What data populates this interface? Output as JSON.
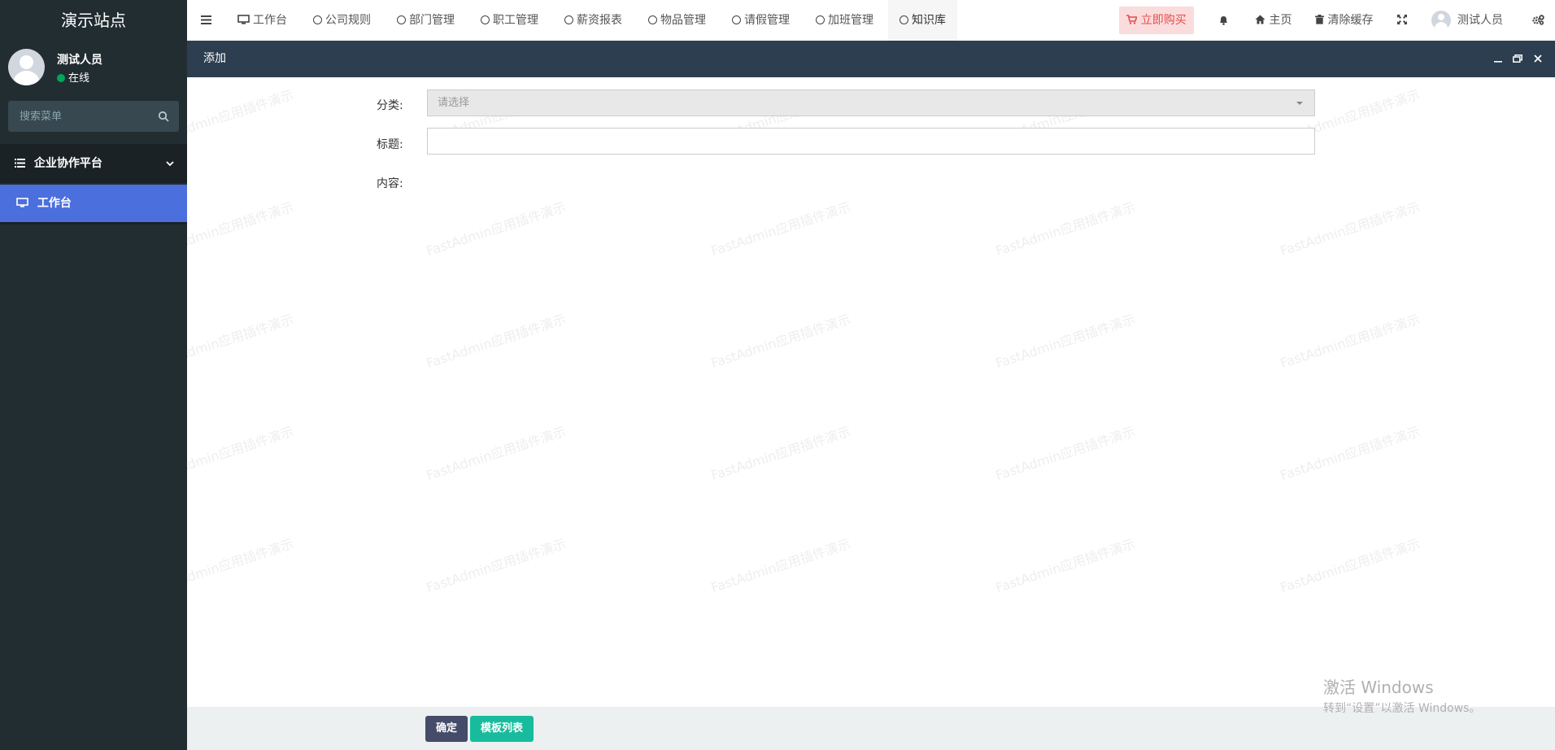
{
  "sidebar": {
    "site_title": "演示站点",
    "user_name": "测试人员",
    "user_status": "在线",
    "search_placeholder": "搜索菜单",
    "menu_group": "企业协作平台",
    "active_item": "工作台"
  },
  "navbar": {
    "tabs": [
      {
        "label": "工作台",
        "icon": "monitor-icon"
      },
      {
        "label": "公司规则",
        "icon": "circle-icon"
      },
      {
        "label": "部门管理",
        "icon": "circle-icon"
      },
      {
        "label": "职工管理",
        "icon": "circle-icon"
      },
      {
        "label": "薪资报表",
        "icon": "circle-icon"
      },
      {
        "label": "物品管理",
        "icon": "circle-icon"
      },
      {
        "label": "请假管理",
        "icon": "circle-icon"
      },
      {
        "label": "加班管理",
        "icon": "circle-icon"
      },
      {
        "label": "知识库",
        "icon": "circle-icon"
      }
    ],
    "buy_label": "立即购买",
    "home_label": "主页",
    "clear_cache_label": "清除缓存",
    "user_name": "测试人员"
  },
  "layer": {
    "title": "添加",
    "category_label": "分类:",
    "category_placeholder": "请选择",
    "title_label": "标题:",
    "content_label": "内容:",
    "confirm_label": "确定",
    "template_label": "模板列表",
    "watermark_text": "FastAdmin应用插件演示"
  },
  "windows_activation": {
    "line1": "激活 Windows",
    "line2": "转到“设置”以激活 Windows。"
  },
  "colors": {
    "sidebar_bg": "#222d32",
    "active_menu": "#4c6fde",
    "layer_title_bg": "#2c3e50",
    "confirm_btn": "#444c69",
    "template_btn": "#18bc9c",
    "buy_btn_text": "#e54c4c"
  }
}
